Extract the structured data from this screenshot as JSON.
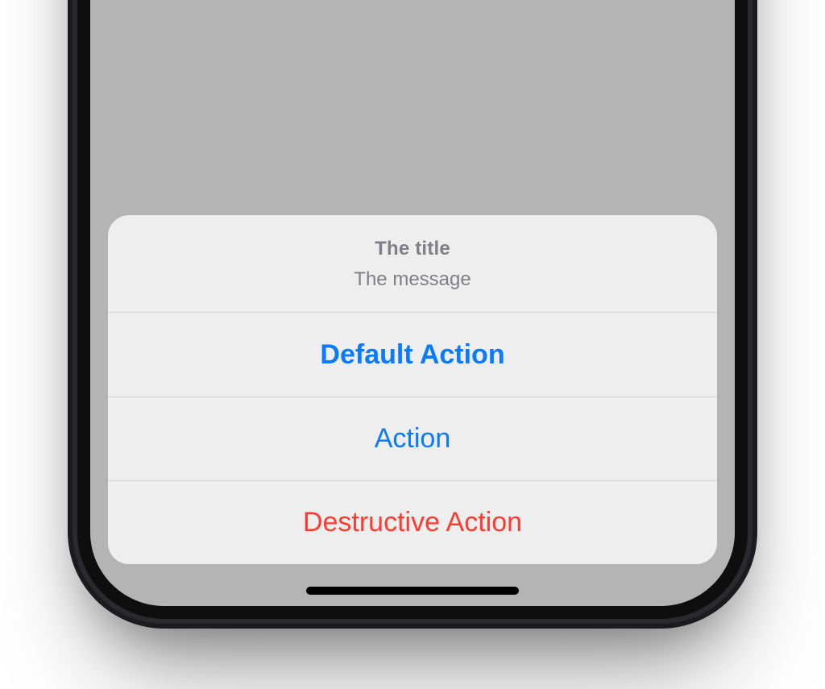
{
  "sheet": {
    "title": "The title",
    "message": "The message",
    "actions": {
      "default": "Default Action",
      "normal": "Action",
      "destructive": "Destructive Action"
    }
  },
  "colors": {
    "ios_blue": "#0a7aff",
    "ios_red": "#ff3b30",
    "sheet_bg": "#efeff0",
    "header_text": "#808084",
    "divider": "#d9d9db",
    "screen_dim": "#b4b4b4",
    "phone_body": "#1b1b1d"
  }
}
